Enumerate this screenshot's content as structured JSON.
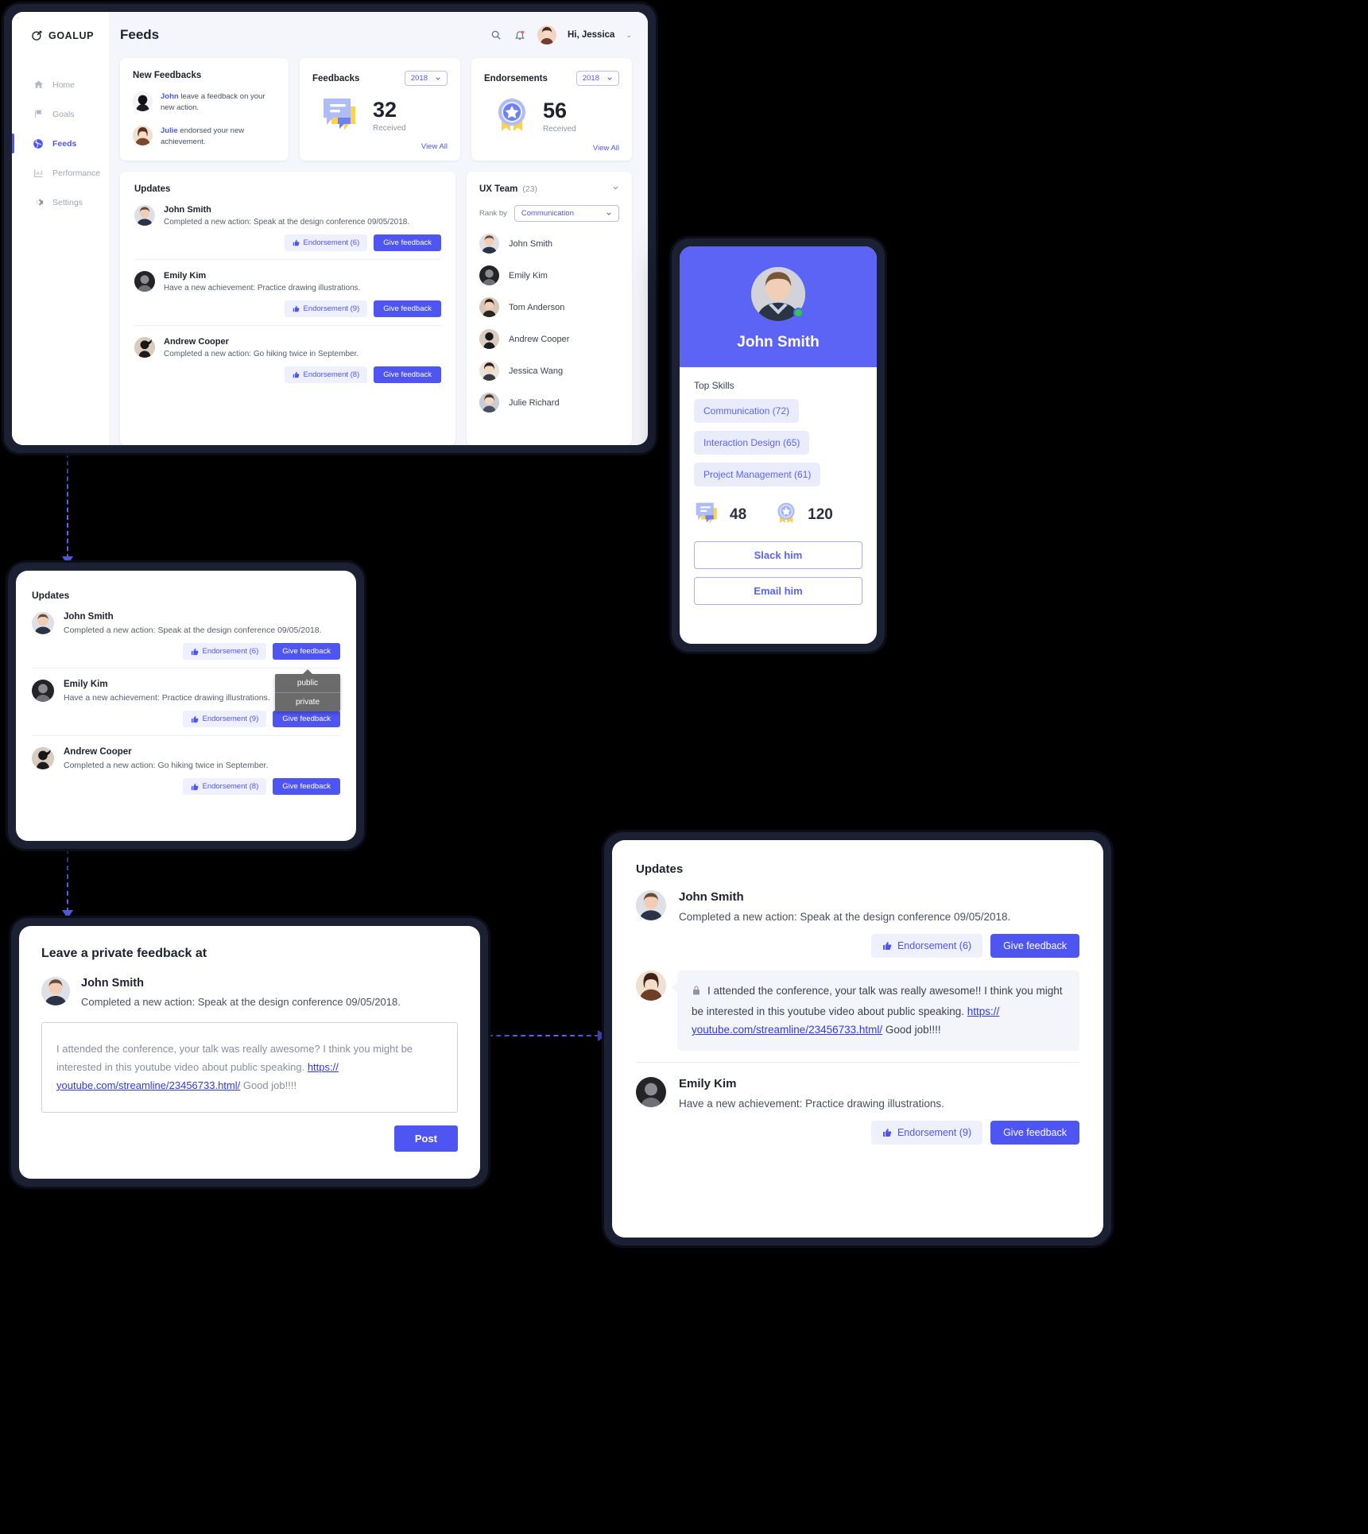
{
  "dashboard": {
    "brand": "GOALUP",
    "nav": [
      {
        "label": "Home",
        "icon": "home-icon"
      },
      {
        "label": "Goals",
        "icon": "flag-icon"
      },
      {
        "label": "Feeds",
        "icon": "globe-icon"
      },
      {
        "label": "Performance",
        "icon": "chart-icon"
      },
      {
        "label": "Settings",
        "icon": "gear-icon"
      }
    ],
    "active_nav": "Feeds",
    "topbar": {
      "title": "Feeds",
      "search_icon": "search-icon",
      "bell_icon": "bell-icon",
      "greeting": "Hi, Jessica",
      "chevron": "⌄"
    },
    "new_feedbacks": {
      "title": "New Feedbacks",
      "items": [
        {
          "name": "John",
          "text": " leave a feedback on your new action."
        },
        {
          "name": "Julie",
          "text": " endorsed your new achievement."
        }
      ]
    },
    "feedbacks": {
      "title": "Feedbacks",
      "year": "2018",
      "value": "32",
      "label": "Received",
      "view_all": "View All"
    },
    "endorsements": {
      "title": "Endorsements",
      "year": "2018",
      "value": "56",
      "label": "Received",
      "view_all": "View All"
    },
    "updates": {
      "title": "Updates",
      "items": [
        {
          "name": "John Smith",
          "desc": "Completed a new action: Speak at the design conference 09/05/2018.",
          "endorsement": "Endorsement (6)",
          "feedback": "Give feedback"
        },
        {
          "name": "Emily Kim",
          "desc": "Have a new achievement: Practice drawing illustrations.",
          "endorsement": "Endorsement (9)",
          "feedback": "Give feedback"
        },
        {
          "name": "Andrew Cooper",
          "desc": "Completed a new action: Go hiking twice in September.",
          "endorsement": "Endorsement (8)",
          "feedback": "Give feedback"
        }
      ]
    },
    "team": {
      "title": "UX Team",
      "count": "(23)",
      "rank_label": "Rank by",
      "rank_value": "Communication",
      "members": [
        {
          "name": "John Smith"
        },
        {
          "name": "Emily Kim"
        },
        {
          "name": "Tom Anderson"
        },
        {
          "name": "Andrew Cooper"
        },
        {
          "name": "Jessica Wang"
        },
        {
          "name": "Julie Richard"
        }
      ]
    }
  },
  "profile": {
    "name": "John Smith",
    "skills_title": "Top Skills",
    "skills": [
      "Communication (72)",
      "Interaction Design (65)",
      "Project Management (61)"
    ],
    "stats": [
      {
        "icon": "feedback-icon",
        "value": "48"
      },
      {
        "icon": "endorsement-badge-icon",
        "value": "120"
      }
    ],
    "slack_button": "Slack him",
    "email_button": "Email him",
    "accent": "#5b64f4",
    "online_dot": "#2ec84a"
  },
  "panel_updates": {
    "title": "Updates",
    "items": [
      {
        "name": "John Smith",
        "desc": "Completed a new action: Speak at the design conference 09/05/2018.",
        "endorsement": "Endorsement (6)",
        "feedback": "Give feedback"
      },
      {
        "name": "Emily Kim",
        "desc": "Have a new achievement: Practice drawing illustrations.",
        "endorsement": "Endorsement (9)",
        "feedback": "Give feedback"
      },
      {
        "name": "Andrew Cooper",
        "desc": "Completed a new action: Go hiking twice in September.",
        "endorsement": "Endorsement (8)",
        "feedback": "Give feedback"
      }
    ],
    "privacy_menu": {
      "options": [
        "public",
        "private"
      ]
    }
  },
  "panel_compose": {
    "title": "Leave a private feedback at",
    "name": "John Smith",
    "desc": "Completed a new action: Speak at the design conference 09/05/2018.",
    "message_part1": "I attended the conference, your talk was really awesome? I think you might be interested in this youtube video about public speaking. ",
    "message_link": "https:// youtube.com/streamline/23456733.html/",
    "message_part2": "  Good job!!!!",
    "post_button": "Post"
  },
  "panel_result": {
    "title": "Updates",
    "post": {
      "name": "John Smith",
      "desc": "Completed a new action: Speak at the design conference 09/05/2018.",
      "endorsement": "Endorsement (6)",
      "feedback": "Give feedback"
    },
    "comment": {
      "lock_icon": "lock-icon",
      "part1": "I attended the conference, your talk was really awesome!! I think you might be interested in this youtube video about public speaking. ",
      "link": "https:// youtube.com/streamline/23456733.html/",
      "part2": "    Good job!!!!"
    },
    "second": {
      "name": "Emily Kim",
      "desc": "Have a new achievement: Practice drawing illustrations.",
      "endorsement": "Endorsement (9)",
      "feedback": "Give feedback"
    }
  }
}
